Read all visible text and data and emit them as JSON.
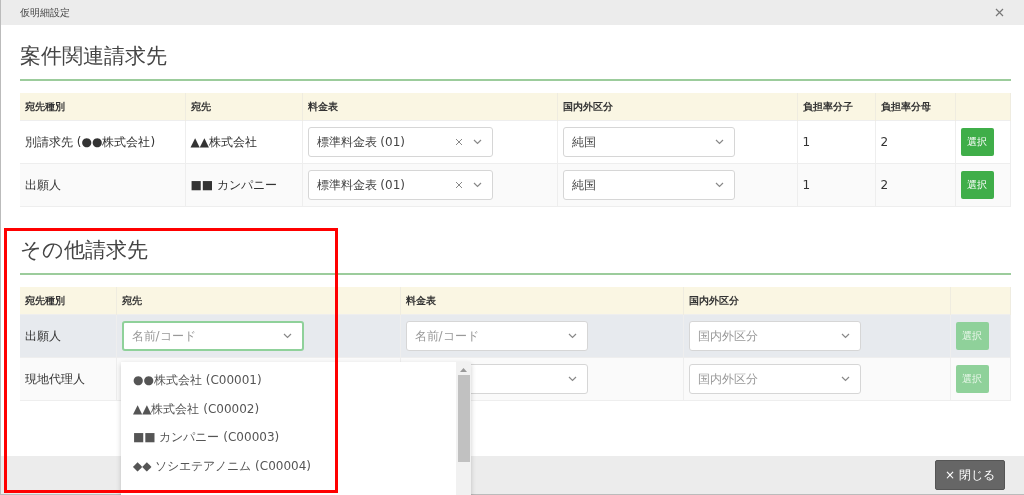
{
  "dialog": {
    "title": "仮明細設定"
  },
  "related": {
    "title": "案件関連請求先",
    "columns": [
      "宛先種別",
      "宛先",
      "料金表",
      "国内外区分",
      "負担率分子",
      "負担率分母"
    ],
    "rows": [
      {
        "type": "別請求先 (●●株式会社)",
        "recipient": "▲▲株式会社",
        "rate_table": {
          "value": "標準料金表 (01)",
          "clearable": true
        },
        "region": {
          "value": "純国"
        },
        "numerator": "1",
        "denominator": "2",
        "button": {
          "label": "選択",
          "disabled": false
        }
      },
      {
        "type": "出願人",
        "recipient": "■■ カンパニー",
        "rate_table": {
          "value": "標準料金表 (01)",
          "clearable": true
        },
        "region": {
          "value": "純国"
        },
        "numerator": "1",
        "denominator": "2",
        "button": {
          "label": "選択",
          "disabled": false
        }
      }
    ]
  },
  "other": {
    "title": "その他請求先",
    "columns": [
      "宛先種別",
      "宛先",
      "料金表",
      "国内外区分"
    ],
    "rows": [
      {
        "type": "出願人",
        "selected": true,
        "recipient": {
          "placeholder": "名前/コード",
          "focused": true
        },
        "rate_table": {
          "placeholder": "名前/コード"
        },
        "region": {
          "placeholder": "国内外区分"
        },
        "button": {
          "label": "選択",
          "disabled": true
        }
      },
      {
        "type": "現地代理人",
        "selected": false,
        "recipient": {},
        "rate_table": {},
        "region": {
          "placeholder": "国内外区分"
        },
        "button": {
          "label": "選択",
          "disabled": true
        }
      }
    ],
    "dropdown": {
      "options": [
        "●●株式会社 (C00001)",
        "▲▲株式会社 (C00002)",
        "■■ カンパニー (C00003)",
        "◆◆ ソシエテアノニム (C00004)"
      ]
    }
  },
  "footer": {
    "close_button": "× 閉じる"
  }
}
